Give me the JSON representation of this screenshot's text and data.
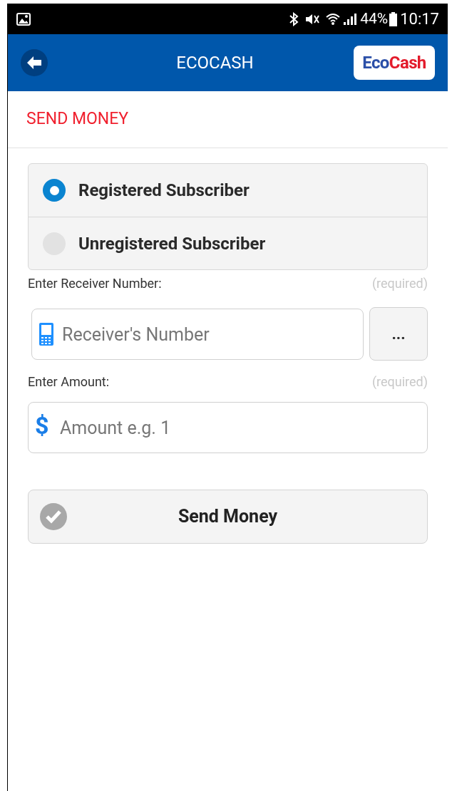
{
  "status_bar": {
    "battery": "44%",
    "time": "10:17"
  },
  "header": {
    "title": "ECOCASH",
    "logo": [
      "Eco",
      "Cash"
    ]
  },
  "section_title": "SEND MONEY",
  "subscriber_options": [
    {
      "label": "Registered Subscriber",
      "selected": true
    },
    {
      "label": "Unregistered Subscriber",
      "selected": false
    }
  ],
  "receiver": {
    "label": "Enter Receiver Number:",
    "required": "(required)",
    "placeholder": "Receiver's Number",
    "more_button": "..."
  },
  "amount": {
    "label": "Enter Amount:",
    "required": "(required)",
    "currency": "$",
    "placeholder": "Amount e.g. 1"
  },
  "submit_button": "Send Money"
}
